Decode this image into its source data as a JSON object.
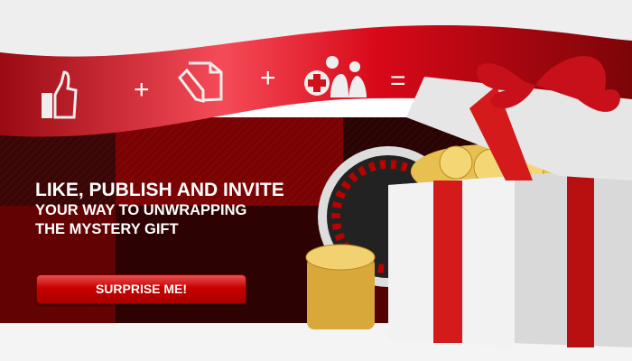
{
  "ribbon": {
    "icons": [
      "thumbs-up-icon",
      "document-attach-icon",
      "add-friends-icon"
    ],
    "operators": [
      "+",
      "+",
      "="
    ]
  },
  "headline": {
    "line1": "LIKE, PUBLISH AND INVITE",
    "line2": "YOUR WAY TO UNWRAPPING",
    "line3": "THE MYSTERY GIFT"
  },
  "cta": {
    "label": "SURPRISE ME!"
  },
  "colors": {
    "accent": "#e30613",
    "dark": "#3a0505"
  }
}
